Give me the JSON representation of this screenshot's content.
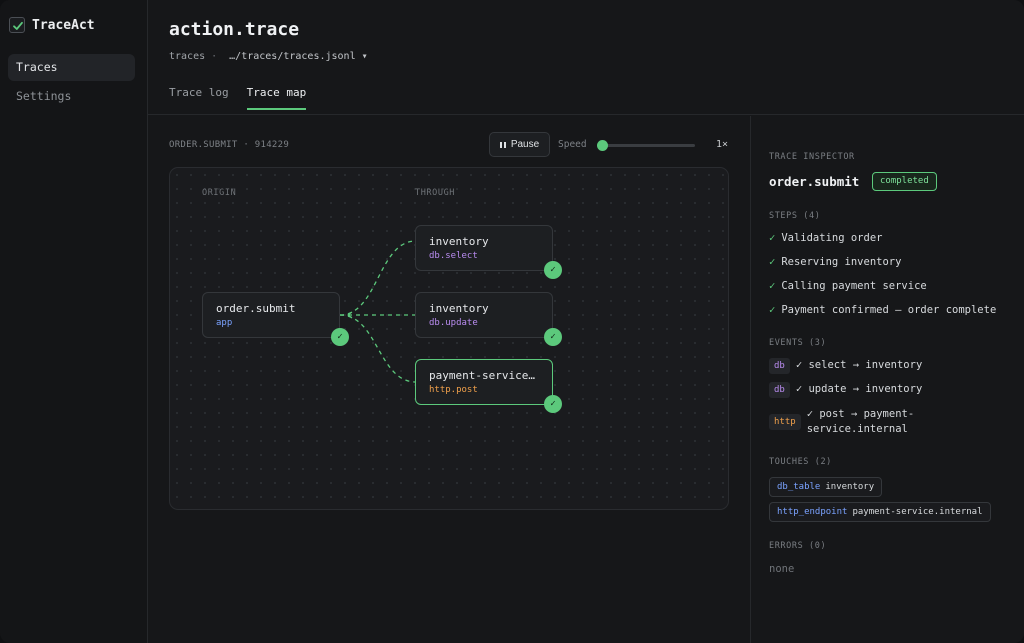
{
  "app": {
    "name": "TraceAct"
  },
  "sidebar": {
    "items": [
      {
        "label": "Traces"
      },
      {
        "label": "Settings"
      }
    ]
  },
  "header": {
    "title": "action.trace",
    "breadcrumb_root": "traces",
    "breadcrumb_sep": "·",
    "file": "…/traces/traces.jsonl ▾"
  },
  "tabs": [
    {
      "label": "Trace log"
    },
    {
      "label": "Trace map"
    }
  ],
  "toolbar": {
    "run_label": "ORDER.SUBMIT · 914229",
    "pause_label": "Pause",
    "speed_label": "Speed",
    "speed_value": "1×",
    "speed_fraction": 0.0
  },
  "map": {
    "origin_label": "ORIGIN",
    "through_label": "THROUGH",
    "nodes": [
      {
        "name": "order.submit",
        "kind": "app"
      },
      {
        "name": "inventory",
        "kind": "db.select"
      },
      {
        "name": "inventory",
        "kind": "db.update"
      },
      {
        "name": "payment-service.i…",
        "kind": "http.post"
      }
    ],
    "check_glyph": "✓"
  },
  "inspector": {
    "section_label": "TRACE INSPECTOR",
    "title": "order.submit",
    "status": "completed",
    "steps_label": "STEPS (4)",
    "steps": [
      {
        "text": "Validating order"
      },
      {
        "text": "Reserving inventory"
      },
      {
        "text": "Calling payment service"
      },
      {
        "text": "Payment confirmed — order complete"
      }
    ],
    "events_label": "EVENTS (3)",
    "events": [
      {
        "tag": "db",
        "text": "✓ select → inventory"
      },
      {
        "tag": "db",
        "text": "✓ update → inventory"
      },
      {
        "tag": "http",
        "line1": "✓ post → payment-",
        "line2": "service.internal"
      }
    ],
    "touches_label": "TOUCHES (2)",
    "touches": [
      {
        "type": "db_table",
        "value": "inventory"
      },
      {
        "type": "http_endpoint",
        "value": "payment-service.internal"
      }
    ],
    "errors_label": "ERRORS (0)",
    "errors_text": "none"
  },
  "colors": {
    "accent": "#5cc97c",
    "app": "#7aa2ff",
    "db": "#b98cf0",
    "http": "#f0a04b"
  }
}
